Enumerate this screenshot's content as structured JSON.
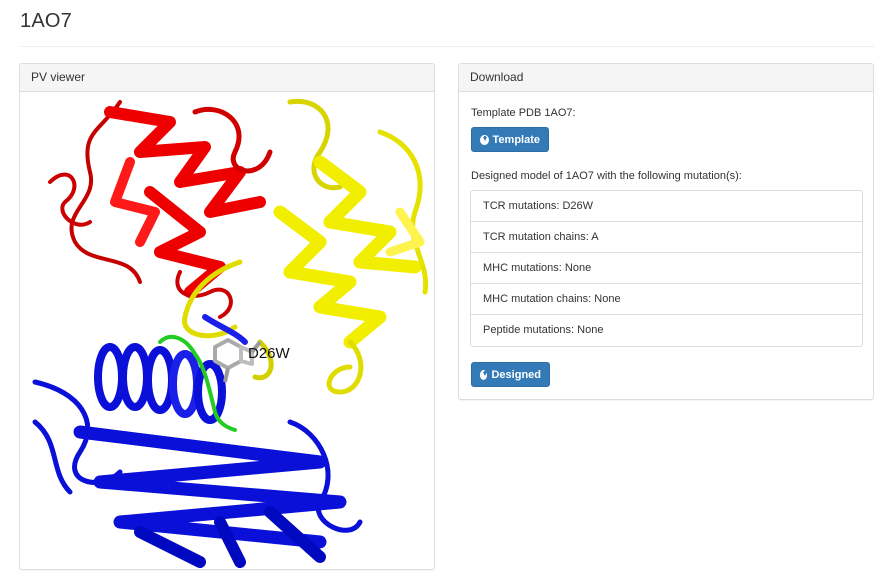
{
  "page": {
    "title": "1AO7"
  },
  "viewer": {
    "heading": "PV viewer",
    "label": "D26W"
  },
  "download": {
    "heading": "Download",
    "template_text": "Template PDB 1AO7:",
    "template_button": "Template",
    "designed_text": "Designed model of 1AO7 with the following mutation(s):",
    "mutations": [
      "TCR mutations: D26W",
      "TCR mutation chains: A",
      "MHC mutations: None",
      "MHC mutation chains: None",
      "Peptide mutations: None"
    ],
    "designed_button": "Designed"
  },
  "colors": {
    "accent": "#337ab7",
    "chain_red": "#ee0000",
    "chain_yellow": "#f2ee00",
    "chain_blue": "#0a10d8",
    "peptide_green": "#22cc22"
  },
  "icons": {
    "button_icon": "download-circle-icon"
  }
}
